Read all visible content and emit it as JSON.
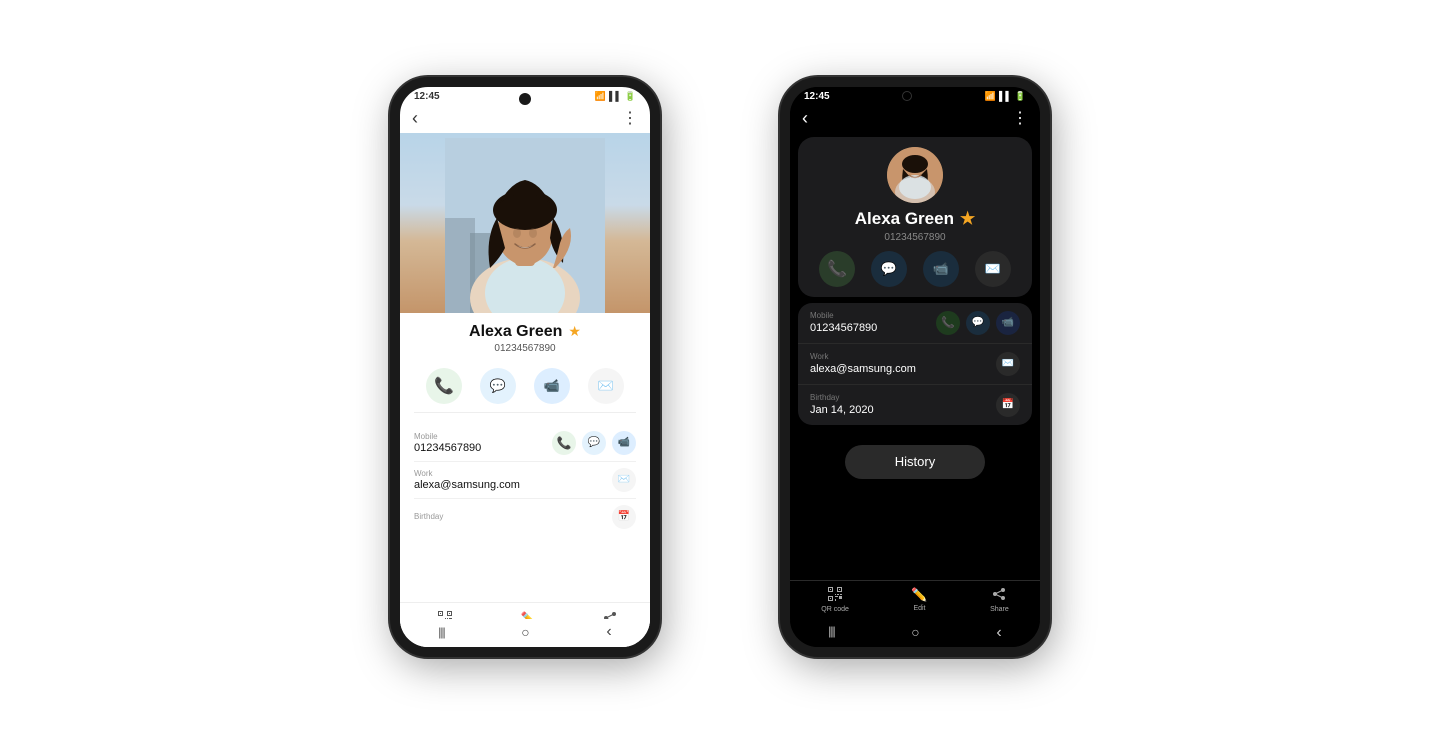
{
  "phone_light": {
    "status_bar": {
      "time": "12:45",
      "wifi": "wifi",
      "signal": "signal",
      "battery": "battery"
    },
    "nav": {
      "back_icon": "‹",
      "menu_icon": "⋮"
    },
    "contact": {
      "name": "Alexa Green",
      "phone": "01234567890",
      "star": "★",
      "actions": {
        "call_label": "call",
        "message_label": "message",
        "video_label": "video",
        "email_label": "email"
      }
    },
    "details": {
      "mobile_label": "Mobile",
      "mobile_value": "01234567890",
      "work_label": "Work",
      "work_value": "alexa@samsung.com",
      "birthday_label": "Birthday",
      "birthday_value": ""
    },
    "bottom_nav": {
      "qr_label": "QR code",
      "edit_label": "Edit",
      "share_label": "Share"
    },
    "system_nav": {
      "recent": "|||",
      "home": "○",
      "back": "‹"
    }
  },
  "phone_dark": {
    "status_bar": {
      "time": "12:45",
      "camera": "camera",
      "wifi": "wifi",
      "signal": "signal",
      "battery": "battery"
    },
    "nav": {
      "back_icon": "‹",
      "menu_icon": "⋮"
    },
    "contact": {
      "name": "Alexa Green",
      "phone": "01234567890",
      "star": "★",
      "actions": {
        "call_label": "call",
        "message_label": "message",
        "video_label": "video",
        "email_label": "email"
      }
    },
    "details": {
      "mobile_label": "Mobile",
      "mobile_value": "01234567890",
      "work_label": "Work",
      "work_value": "alexa@samsung.com",
      "birthday_label": "Birthday",
      "birthday_value": "Jan 14, 2020",
      "history_button": "History"
    },
    "bottom_nav": {
      "qr_label": "QR code",
      "edit_label": "Edit",
      "share_label": "Share"
    },
    "system_nav": {
      "recent": "|||",
      "home": "○",
      "back": "‹"
    }
  }
}
